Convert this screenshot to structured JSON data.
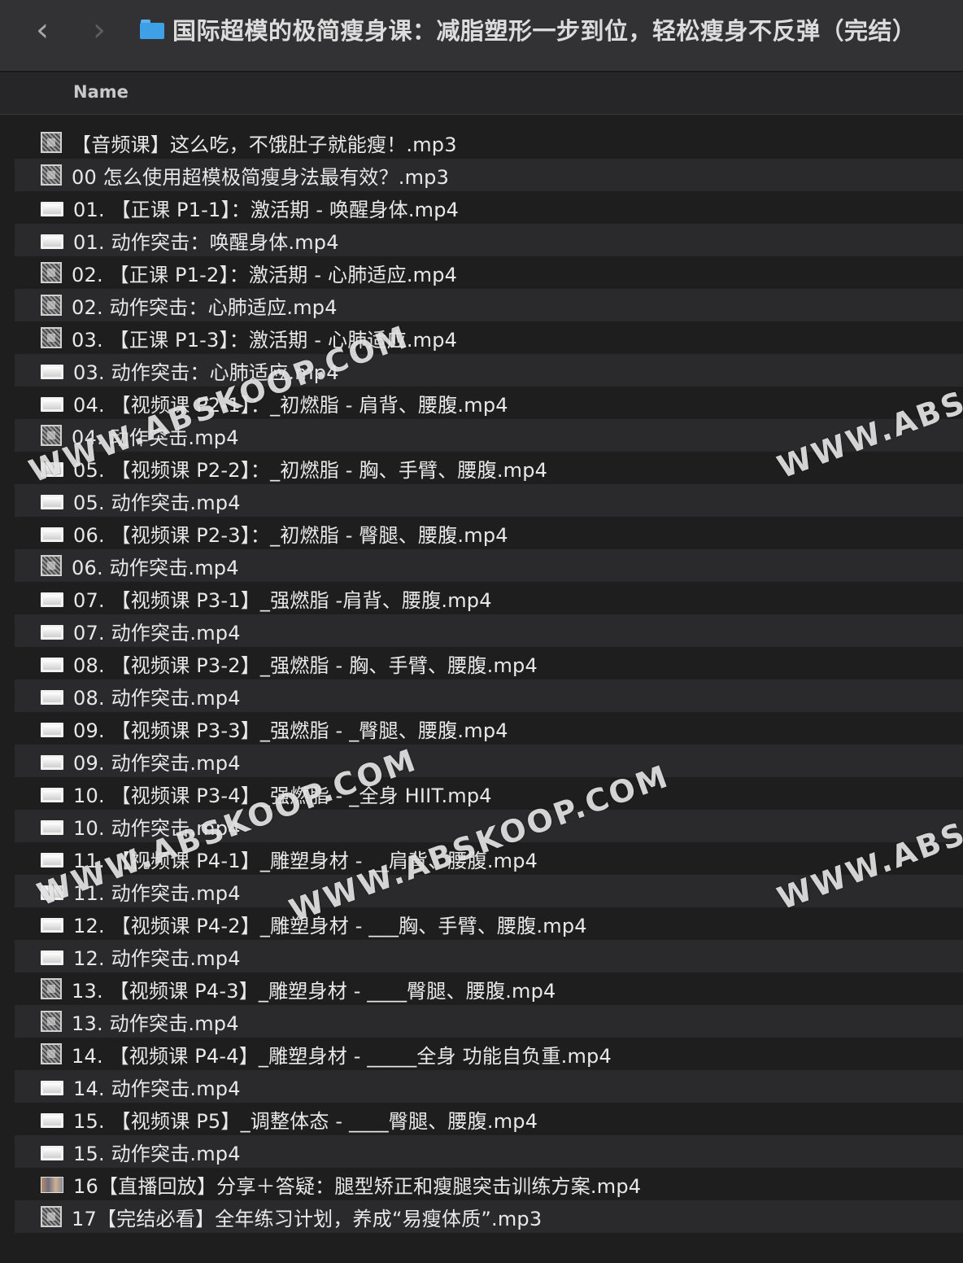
{
  "window": {
    "title": "国际超模的极简瘦身课：减脂塑形一步到位，轻松瘦身不反弹（完结）",
    "back_icon": "‹",
    "forward_icon": "›"
  },
  "list_header": {
    "name_label": "Name"
  },
  "files": [
    {
      "name": "【音频课】这么吃，不饿肚子就能瘦！.mp3",
      "icon": "audio"
    },
    {
      "name": "00 怎么使用超模极简瘦身法最有效？.mp3",
      "icon": "audio"
    },
    {
      "name": "01. 【正课 P1-1】：激活期 - 唤醒身体.mp4",
      "icon": "video"
    },
    {
      "name": "01. 动作突击：唤醒身体.mp4",
      "icon": "video"
    },
    {
      "name": "02. 【正课 P1-2】：激活期 - 心肺适应.mp4",
      "icon": "audio"
    },
    {
      "name": "02. 动作突击：心肺适应.mp4",
      "icon": "audio"
    },
    {
      "name": "03. 【正课 P1-3】：激活期 - 心肺适应.mp4",
      "icon": "audio"
    },
    {
      "name": "03. 动作突击：心肺适应.mp4",
      "icon": "video"
    },
    {
      "name": "04. 【视频课 P2-1】：_初燃脂 - 肩背、腰腹.mp4",
      "icon": "video"
    },
    {
      "name": "04. 动作突击.mp4",
      "icon": "audio"
    },
    {
      "name": "05. 【视频课 P2-2】：_初燃脂 - 胸、手臂、腰腹.mp4",
      "icon": "video"
    },
    {
      "name": "05. 动作突击.mp4",
      "icon": "video"
    },
    {
      "name": "06. 【视频课 P2-3】：_初燃脂 - 臀腿、腰腹.mp4",
      "icon": "video"
    },
    {
      "name": "06. 动作突击.mp4",
      "icon": "audio"
    },
    {
      "name": "07. 【视频课 P3-1】_强燃脂 -肩背、腰腹.mp4",
      "icon": "video"
    },
    {
      "name": "07. 动作突击.mp4",
      "icon": "video"
    },
    {
      "name": "08. 【视频课 P3-2】_强燃脂 - 胸、手臂、腰腹.mp4",
      "icon": "video"
    },
    {
      "name": "08. 动作突击.mp4",
      "icon": "video"
    },
    {
      "name": "09. 【视频课 P3-3】_强燃脂 - _臀腿、腰腹.mp4",
      "icon": "video"
    },
    {
      "name": "09. 动作突击.mp4",
      "icon": "video"
    },
    {
      "name": "10. 【视频课 P3-4】_强燃脂 - _全身 HIIT.mp4",
      "icon": "video"
    },
    {
      "name": "10. 动作突击.mp4",
      "icon": "video"
    },
    {
      "name": "11. 【视频课 P4-1】_雕塑身材 - __肩背、腰腹.mp4",
      "icon": "video"
    },
    {
      "name": "11. 动作突击.mp4",
      "icon": "video"
    },
    {
      "name": "12. 【视频课 P4-2】_雕塑身材 - ___胸、手臂、腰腹.mp4",
      "icon": "video"
    },
    {
      "name": "12. 动作突击.mp4",
      "icon": "video"
    },
    {
      "name": "13. 【视频课 P4-3】_雕塑身材 - ____臀腿、腰腹.mp4",
      "icon": "audio"
    },
    {
      "name": "13. 动作突击.mp4",
      "icon": "audio"
    },
    {
      "name": "14. 【视频课 P4-4】_雕塑身材 - _____全身 功能自负重.mp4",
      "icon": "audio"
    },
    {
      "name": "14. 动作突击.mp4",
      "icon": "video"
    },
    {
      "name": "15. 【视频课 P5】_调整体态 - ____臀腿、腰腹.mp4",
      "icon": "video"
    },
    {
      "name": "15. 动作突击.mp4",
      "icon": "video"
    },
    {
      "name": "16【直播回放】分享＋答疑：腿型矫正和瘦腿突击训练方案.mp4",
      "icon": "movie"
    },
    {
      "name": "17【完结必看】全年练习计划，养成“易瘦体质”.mp3",
      "icon": "audio"
    }
  ],
  "watermarks": [
    {
      "text": "WWW.ABSKOOP.COM"
    },
    {
      "text": "WWW.ABSKOOP.COM"
    },
    {
      "text": "WWW.ABSKOOP.COM"
    },
    {
      "text": "WWW.ABSKOOP.COM"
    },
    {
      "text": "WWW.ABSKOOP.COM"
    }
  ],
  "colors": {
    "background": "#1e1e1f",
    "row_alt": "#2a2a2c",
    "titlebar": "#323234",
    "folder_icon": "#3ea0e6"
  }
}
